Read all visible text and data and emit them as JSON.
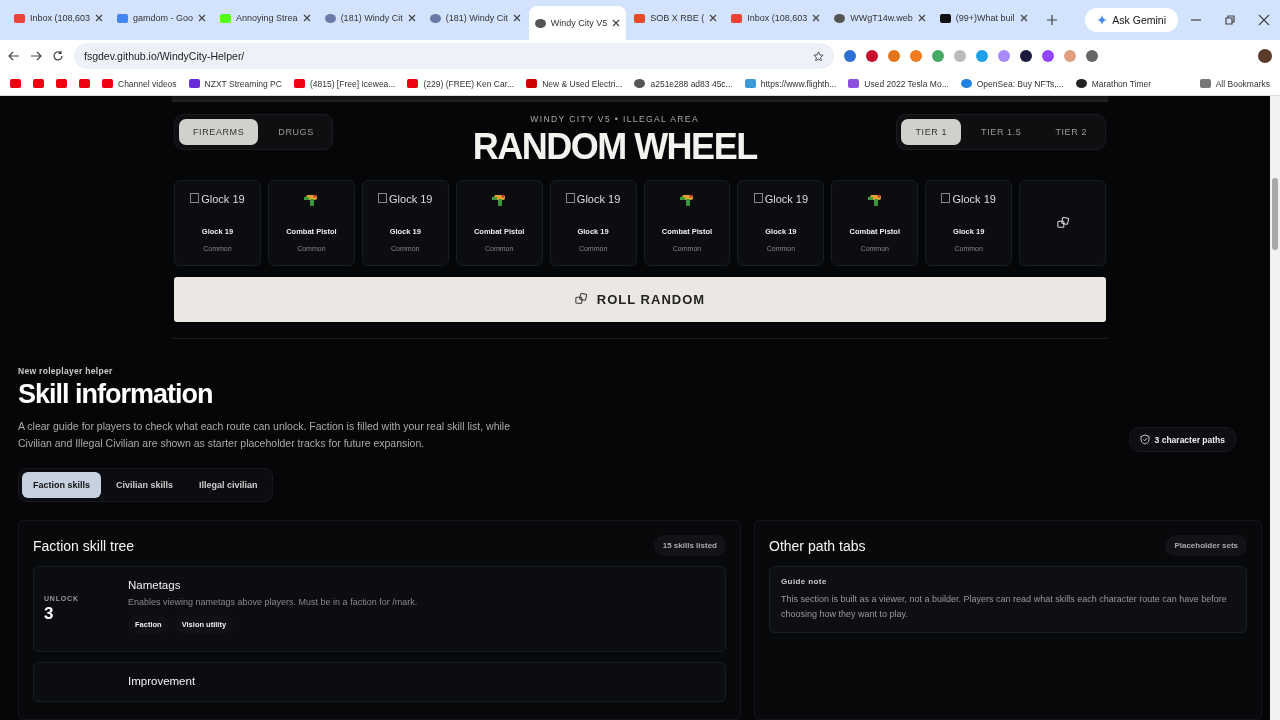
{
  "browser": {
    "tabs": [
      {
        "title": "Inbox (108,603",
        "kind": "mail",
        "selected": false
      },
      {
        "title": "gamdom - Goo",
        "kind": "google",
        "selected": false
      },
      {
        "title": "Annoying Strea",
        "kind": "kick",
        "selected": false
      },
      {
        "title": "(181) Windy Cit",
        "kind": "avatar",
        "selected": false
      },
      {
        "title": "(181) Windy Cit",
        "kind": "avatar",
        "selected": false
      },
      {
        "title": "Windy City V5",
        "kind": "globe",
        "selected": true
      },
      {
        "title": "SOB X RBE (",
        "kind": "music",
        "selected": false
      },
      {
        "title": "Inbox (108,603",
        "kind": "mail",
        "selected": false
      },
      {
        "title": "WWgT14w.web",
        "kind": "globe",
        "selected": false
      },
      {
        "title": "(99+)What buil",
        "kind": "tiktok",
        "selected": false
      }
    ],
    "gemini": "Ask Gemini",
    "url": "fsgdev.github.io/WindyCity-Helper/",
    "bookmarks": [
      {
        "label": "Channel videos",
        "kind": "youtube"
      },
      {
        "label": "NZXT Streaming PC",
        "kind": "nzxt"
      },
      {
        "label": "(4815) [Free] Icewea...",
        "kind": "youtube"
      },
      {
        "label": "(229) (FREE) Ken Car...",
        "kind": "youtube"
      },
      {
        "label": "New & Used Electri...",
        "kind": "tesla"
      },
      {
        "label": "a251e288 ad83 45c...",
        "kind": "globe"
      },
      {
        "label": "https://www.flighth...",
        "kind": "chart"
      },
      {
        "label": "Used 2022 Tesla Mo...",
        "kind": "purple"
      },
      {
        "label": "OpenSea: Buy NFTs,...",
        "kind": "opensea"
      },
      {
        "label": "Marathon Timer",
        "kind": "timer"
      }
    ],
    "all_bookmarks": "All Bookmarks"
  },
  "wheel": {
    "eyebrow": "WINDY CITY V5 • ILLEGAL AREA",
    "title": "RANDOM WHEEL",
    "categories": [
      {
        "label": "FIREARMS",
        "selected": true
      },
      {
        "label": "DRUGS",
        "selected": false
      }
    ],
    "tiers": [
      {
        "label": "TIER 1",
        "selected": true
      },
      {
        "label": "TIER 1.5",
        "selected": false
      },
      {
        "label": "TIER 2",
        "selected": false
      }
    ],
    "items": [
      {
        "kind": "broken",
        "alt": "Glock 19",
        "name": "Glock 19",
        "rarity": "Common"
      },
      {
        "kind": "gun",
        "name": "Combat Pistol",
        "rarity": "Common"
      },
      {
        "kind": "broken",
        "alt": "Glock 19",
        "name": "Glock 19",
        "rarity": "Common"
      },
      {
        "kind": "gun",
        "name": "Combat Pistol",
        "rarity": "Common"
      },
      {
        "kind": "broken",
        "alt": "Glock 19",
        "name": "Glock 19",
        "rarity": "Common"
      },
      {
        "kind": "gun",
        "name": "Combat Pistol",
        "rarity": "Common"
      },
      {
        "kind": "broken",
        "alt": "Glock 19",
        "name": "Glock 19",
        "rarity": "Common"
      },
      {
        "kind": "gun",
        "name": "Combat Pistol",
        "rarity": "Common"
      },
      {
        "kind": "broken",
        "alt": "Glock 19",
        "name": "Glock 19",
        "rarity": "Common"
      },
      {
        "kind": "dice"
      }
    ],
    "roll_button": "ROLL RANDOM"
  },
  "skills": {
    "eyebrow": "New roleplayer helper",
    "title": "Skill information",
    "description": "A clear guide for players to check what each route can unlock. Faction is filled with your real skill list, while Civilian and Illegal Civilian are shown as starter placeholder tracks for future expansion.",
    "paths_badge": "3 character paths",
    "tabs": [
      {
        "label": "Faction skills",
        "selected": true
      },
      {
        "label": "Civilian skills",
        "selected": false
      },
      {
        "label": "Illegal civilian",
        "selected": false
      }
    ],
    "tree": {
      "title": "Faction skill tree",
      "count": "15 skills listed",
      "rows": [
        {
          "unlock_label": "UNLOCK",
          "unlock": "3",
          "name": "Nametags",
          "description": "Enables viewing nametags above players. Must be in a faction for /mark.",
          "tags": [
            "Faction",
            "Vision utility"
          ]
        },
        {
          "name": "Improvement"
        }
      ]
    },
    "other": {
      "title": "Other path tabs",
      "badge": "Placeholder sets",
      "note_title": "Guide note",
      "note": "This section is built as a viewer, not a builder. Players can read what skills each character route can have before choosing how they want to play."
    }
  }
}
